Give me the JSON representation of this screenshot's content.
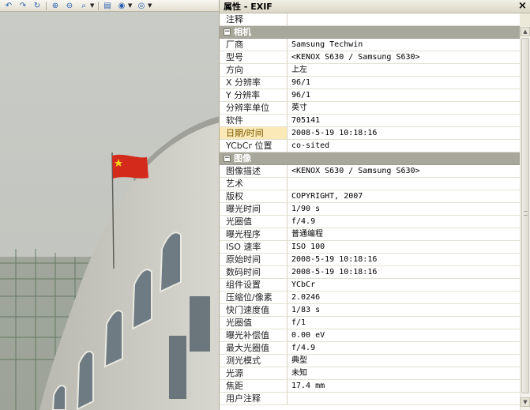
{
  "toolbar": {
    "icons": [
      {
        "name": "undo-icon",
        "glyph": "↶"
      },
      {
        "name": "redo-icon",
        "glyph": "↷"
      },
      {
        "name": "refresh-icon",
        "glyph": "↻"
      },
      {
        "name": "zoom-in-icon",
        "glyph": "⊕"
      },
      {
        "name": "zoom-out-icon",
        "glyph": "⊖"
      },
      {
        "name": "zoom-icon",
        "glyph": "⌕"
      },
      {
        "name": "print-icon",
        "glyph": "▤"
      },
      {
        "name": "globe-icon",
        "glyph": "◉"
      },
      {
        "name": "disc-icon",
        "glyph": "◎"
      },
      {
        "name": "open-icon",
        "glyph": "▣"
      },
      {
        "name": "edit-icon",
        "glyph": "✎"
      },
      {
        "name": "delete-icon",
        "glyph": "✕"
      },
      {
        "name": "document-icon",
        "glyph": "▯"
      },
      {
        "name": "help-icon",
        "glyph": "?"
      }
    ]
  },
  "panel": {
    "title": "属性 - EXIF",
    "close_label": "×"
  },
  "rows": [
    {
      "type": "prop",
      "label": "注释",
      "value": ""
    },
    {
      "type": "cat",
      "label": "相机"
    },
    {
      "type": "prop",
      "label": "厂商",
      "value": "Samsung Techwin"
    },
    {
      "type": "prop",
      "label": "型号",
      "value": "<KENOX S630  / Samsung S630>"
    },
    {
      "type": "prop",
      "label": "方向",
      "value": "上左"
    },
    {
      "type": "prop",
      "label": "X 分辨率",
      "value": "96/1"
    },
    {
      "type": "prop",
      "label": "Y 分辨率",
      "value": "96/1"
    },
    {
      "type": "prop",
      "label": "分辨率单位",
      "value": "英寸"
    },
    {
      "type": "prop",
      "label": "软件",
      "value": "705141"
    },
    {
      "type": "prop",
      "label": "日期/时间",
      "value": "2008-5-19 10:18:16",
      "highlight": true
    },
    {
      "type": "prop",
      "label": "YCbCr 位置",
      "value": "co-sited"
    },
    {
      "type": "cat",
      "label": "图像"
    },
    {
      "type": "prop",
      "label": "图像描述",
      "value": "<KENOX S630  / Samsung S630>"
    },
    {
      "type": "prop",
      "label": "艺术",
      "value": ""
    },
    {
      "type": "prop",
      "label": "版权",
      "value": "COPYRIGHT, 2007"
    },
    {
      "type": "prop",
      "label": "曝光时间",
      "value": "1/90 s"
    },
    {
      "type": "prop",
      "label": "光圈值",
      "value": "f/4.9"
    },
    {
      "type": "prop",
      "label": "曝光程序",
      "value": "普通编程"
    },
    {
      "type": "prop",
      "label": "ISO 速率",
      "value": "ISO 100"
    },
    {
      "type": "prop",
      "label": "原始时间",
      "value": "2008-5-19 10:18:16"
    },
    {
      "type": "prop",
      "label": "数码时间",
      "value": "2008-5-19 10:18:16"
    },
    {
      "type": "prop",
      "label": "组件设置",
      "value": "YCbCr"
    },
    {
      "type": "prop",
      "label": "压缩位/像素",
      "value": "2.0246"
    },
    {
      "type": "prop",
      "label": "快门速度值",
      "value": "1/83 s"
    },
    {
      "type": "prop",
      "label": "光圈值",
      "value": "f/1"
    },
    {
      "type": "prop",
      "label": "曝光补偿值",
      "value": "0.00 eV"
    },
    {
      "type": "prop",
      "label": "最大光圈值",
      "value": "f/4.9"
    },
    {
      "type": "prop",
      "label": "测光模式",
      "value": "典型"
    },
    {
      "type": "prop",
      "label": "光源",
      "value": "未知"
    },
    {
      "type": "prop",
      "label": "焦距",
      "value": "17.4 mm"
    },
    {
      "type": "prop",
      "label": "用户注释",
      "value": ""
    }
  ],
  "colors": {
    "flag": "#d42a1c",
    "highlight": "#fbe9b7",
    "category": "#a8a79b"
  }
}
